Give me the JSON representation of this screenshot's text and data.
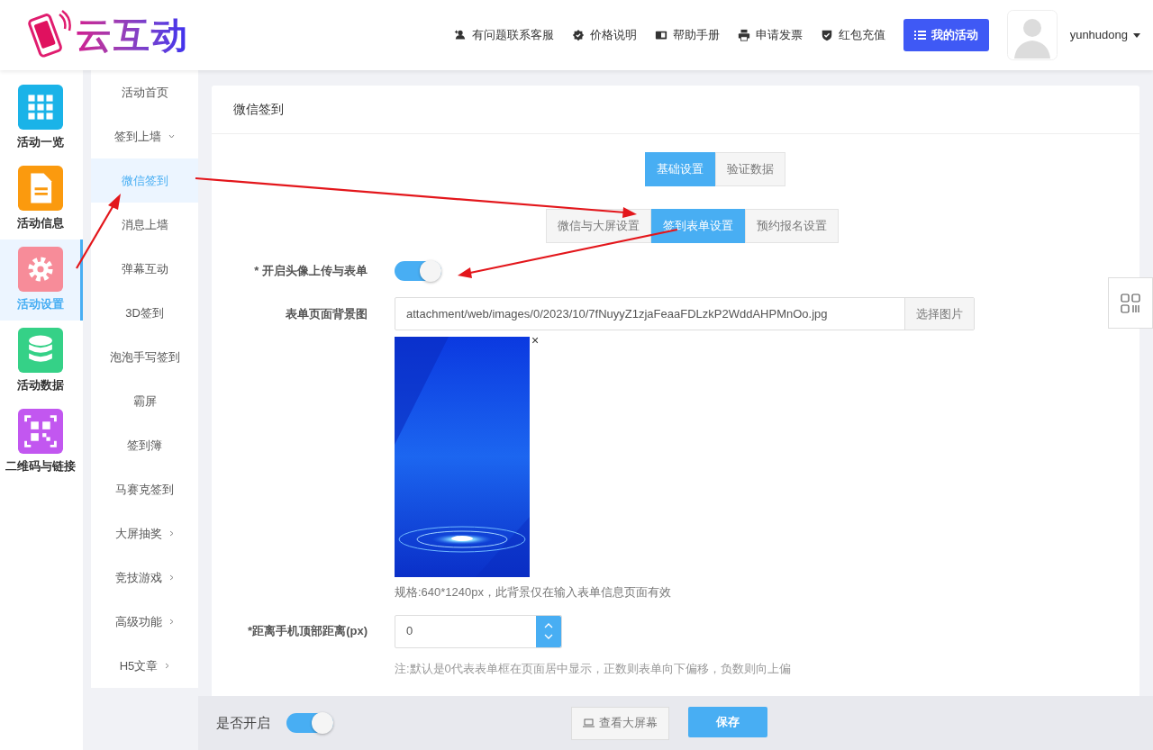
{
  "header": {
    "logo_text": "云互动",
    "links": [
      {
        "kind": "user-plus",
        "label": "有问题联系客服"
      },
      {
        "kind": "badge",
        "label": "价格说明"
      },
      {
        "kind": "book",
        "label": "帮助手册"
      },
      {
        "kind": "printer",
        "label": "申请发票"
      },
      {
        "kind": "shield",
        "label": "红包充值"
      }
    ],
    "primary_button": "我的活动",
    "username": "yunhudong"
  },
  "sidebar": {
    "items": [
      {
        "label": "活动一览",
        "kind": "grid",
        "color": "#1ab3e8",
        "selected": false
      },
      {
        "label": "活动信息",
        "kind": "document",
        "color": "#fb9a0e",
        "selected": false
      },
      {
        "label": "活动设置",
        "kind": "gear",
        "color": "#f78c99",
        "selected": true
      },
      {
        "label": "活动数据",
        "kind": "database",
        "color": "#35d187",
        "selected": false
      },
      {
        "label": "二维码与链接",
        "kind": "qr",
        "color": "#c257f0",
        "selected": false
      }
    ]
  },
  "submenu": {
    "items": [
      {
        "label": "活动首页",
        "selected": false
      },
      {
        "label": "签到上墙",
        "selected": false,
        "expanded": true,
        "children": [
          {
            "label": "微信签到",
            "selected": true
          },
          {
            "label": "消息上墙",
            "selected": false
          },
          {
            "label": "弹幕互动",
            "selected": false
          },
          {
            "label": "3D签到",
            "selected": false
          },
          {
            "label": "泡泡手写签到",
            "selected": false
          },
          {
            "label": "霸屏",
            "selected": false
          },
          {
            "label": "签到簿",
            "selected": false
          },
          {
            "label": "马赛克签到",
            "selected": false
          }
        ]
      },
      {
        "label": "大屏抽奖",
        "selected": false,
        "expanded": false
      },
      {
        "label": "竞技游戏",
        "selected": false,
        "expanded": false
      },
      {
        "label": "高级功能",
        "selected": false,
        "expanded": false
      },
      {
        "label": "H5文章",
        "selected": false,
        "expanded": false
      }
    ]
  },
  "card": {
    "title": "微信签到",
    "tabs": [
      {
        "label": "基础设置",
        "selected": true
      },
      {
        "label": "验证数据",
        "selected": false
      }
    ],
    "subtabs": [
      {
        "label": "微信与大屏设置",
        "selected": false
      },
      {
        "label": "签到表单设置",
        "selected": true
      },
      {
        "label": "预约报名设置",
        "selected": false
      }
    ],
    "avatar_toggle": {
      "label": "* 开启头像上传与表单",
      "on": true
    },
    "background": {
      "label": "表单页面背景图",
      "value": "attachment/web/images/0/2023/10/7fNuyyZ1zjaFeaaFDLzkP2WddAHPMnOo.jpg",
      "button": "选择图片",
      "remove": "×",
      "hint": "规格:640*1240px，此背景仅在输入表单信息页面有效"
    },
    "offset": {
      "label": "*距离手机顶部距离(px)",
      "value": "0",
      "note": "注:默认是0代表表单框在页面居中显示，正数则表单向下偏移，负数则向上偏"
    }
  },
  "footer": {
    "label": "是否开启",
    "on": true,
    "buttons": [
      {
        "kind": "secondary",
        "label": "查看大屏幕"
      },
      {
        "kind": "primary",
        "label": "保存"
      }
    ]
  }
}
